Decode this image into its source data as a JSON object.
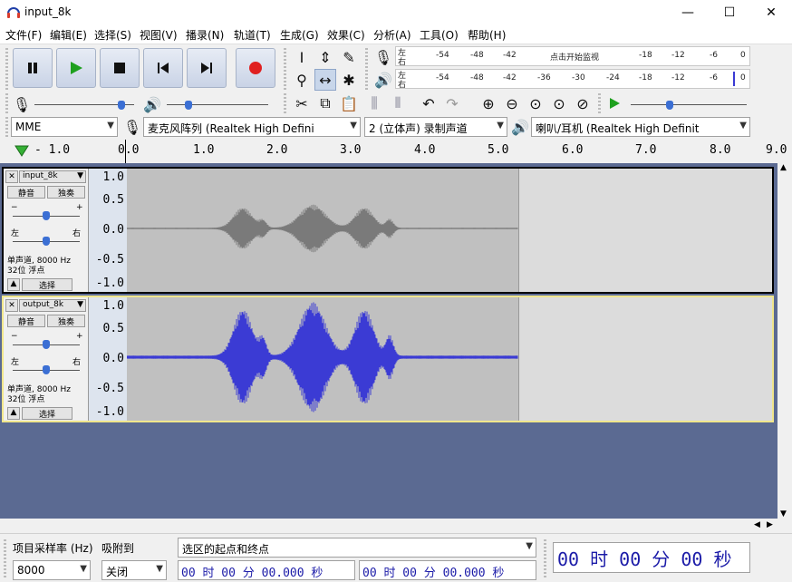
{
  "window": {
    "title": "input_8k",
    "minimize": "—",
    "maximize": "☐",
    "close": "✕"
  },
  "menu": [
    "文件(F)",
    "编辑(E)",
    "选择(S)",
    "视图(V)",
    "播录(N)",
    "轨道(T)",
    "生成(G)",
    "效果(C)",
    "分析(A)",
    "工具(O)",
    "帮助(H)"
  ],
  "meter": {
    "rec_left": "左",
    "rec_right": "右",
    "play_left": "左",
    "play_right": "右",
    "ticks_top": [
      "-54",
      "-48",
      "-42",
      "点击开始监视",
      "-18",
      "-12",
      "-6",
      "0"
    ],
    "ticks_bottom": [
      "-54",
      "-48",
      "-42",
      "-36",
      "-30",
      "-24",
      "-18",
      "-12",
      "-6",
      "0"
    ]
  },
  "devices": {
    "host": "MME",
    "recording": "麦克风阵列 (Realtek High Defini",
    "channels": "2 (立体声) 录制声道",
    "playback": "喇叭/耳机 (Realtek High Definit"
  },
  "ruler": {
    "labels": [
      "- 1.0",
      "0.0",
      "1.0",
      "2.0",
      "3.0",
      "4.0",
      "5.0",
      "6.0",
      "7.0",
      "8.0",
      "9.0"
    ]
  },
  "tracks": [
    {
      "name": "input_8k",
      "mute": "静音",
      "solo": "独奏",
      "pan_left": "左",
      "pan_right": "右",
      "info1": "单声道, 8000 Hz",
      "info2": "32位 浮点",
      "select": "选择",
      "scale": [
        "1.0",
        "0.5",
        "0.0",
        "-0.5",
        "-1.0"
      ],
      "wave_color": "#7a7a7a",
      "selected": false
    },
    {
      "name": "output_8k",
      "mute": "静音",
      "solo": "独奏",
      "pan_left": "左",
      "pan_right": "右",
      "info1": "单声道, 8000 Hz",
      "info2": "32位 浮点",
      "select": "选择",
      "scale": [
        "1.0",
        "0.5",
        "0.0",
        "-0.5",
        "-1.0"
      ],
      "wave_color": "#3b3bd4",
      "selected": true
    }
  ],
  "selection": {
    "rate_label": "项目采样率 (Hz)",
    "snap_label": "吸附到",
    "rate_value": "8000",
    "snap_value": "关闭",
    "mode": "选区的起点和终点",
    "start": "00 时 00 分 00.000 秒",
    "end": "00 时 00 分 00.000 秒",
    "position": "00 时 00 分 00 秒"
  }
}
